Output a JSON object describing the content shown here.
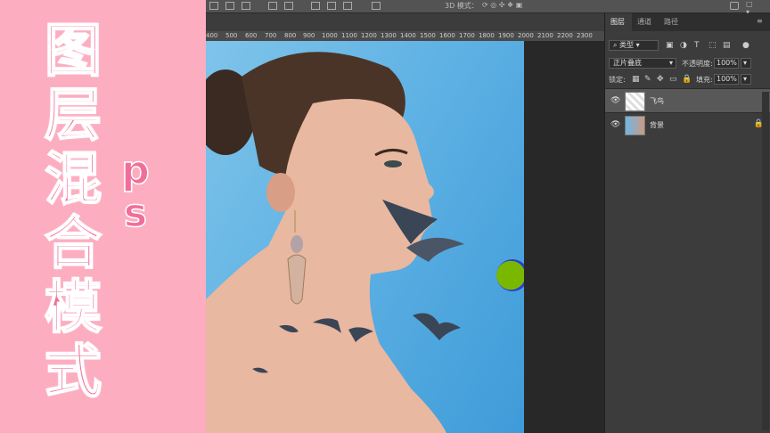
{
  "overlay": {
    "title_chars": [
      "图",
      "层",
      "混",
      "合",
      "模",
      "式"
    ],
    "subtitle_chars": [
      "p",
      "s"
    ]
  },
  "toolbar": {
    "label_3d": "3D 模式："
  },
  "ruler": {
    "ticks": [
      "400",
      "500",
      "600",
      "700",
      "800",
      "900",
      "1000",
      "1100",
      "1200",
      "1300",
      "1400",
      "1500",
      "1600",
      "1700",
      "1800",
      "1900",
      "2000",
      "2100",
      "2200",
      "2300"
    ]
  },
  "layers_panel": {
    "tabs": [
      "图层",
      "通道",
      "路径"
    ],
    "filter_kind": "类型",
    "blend_mode": "正片叠底",
    "opacity_label": "不透明度:",
    "opacity_value": "100%",
    "lock_label": "锁定:",
    "fill_label": "填充:",
    "fill_value": "100%",
    "layers": [
      {
        "name": "飞鸟",
        "selected": true,
        "locked": false
      },
      {
        "name": "背景",
        "selected": false,
        "locked": true
      }
    ]
  },
  "colors": {
    "pink_bg": "#fcaec0",
    "title_color": "#f06f9a",
    "cursor_green": "#7ab800",
    "cursor_blue": "#2a3fd0"
  }
}
